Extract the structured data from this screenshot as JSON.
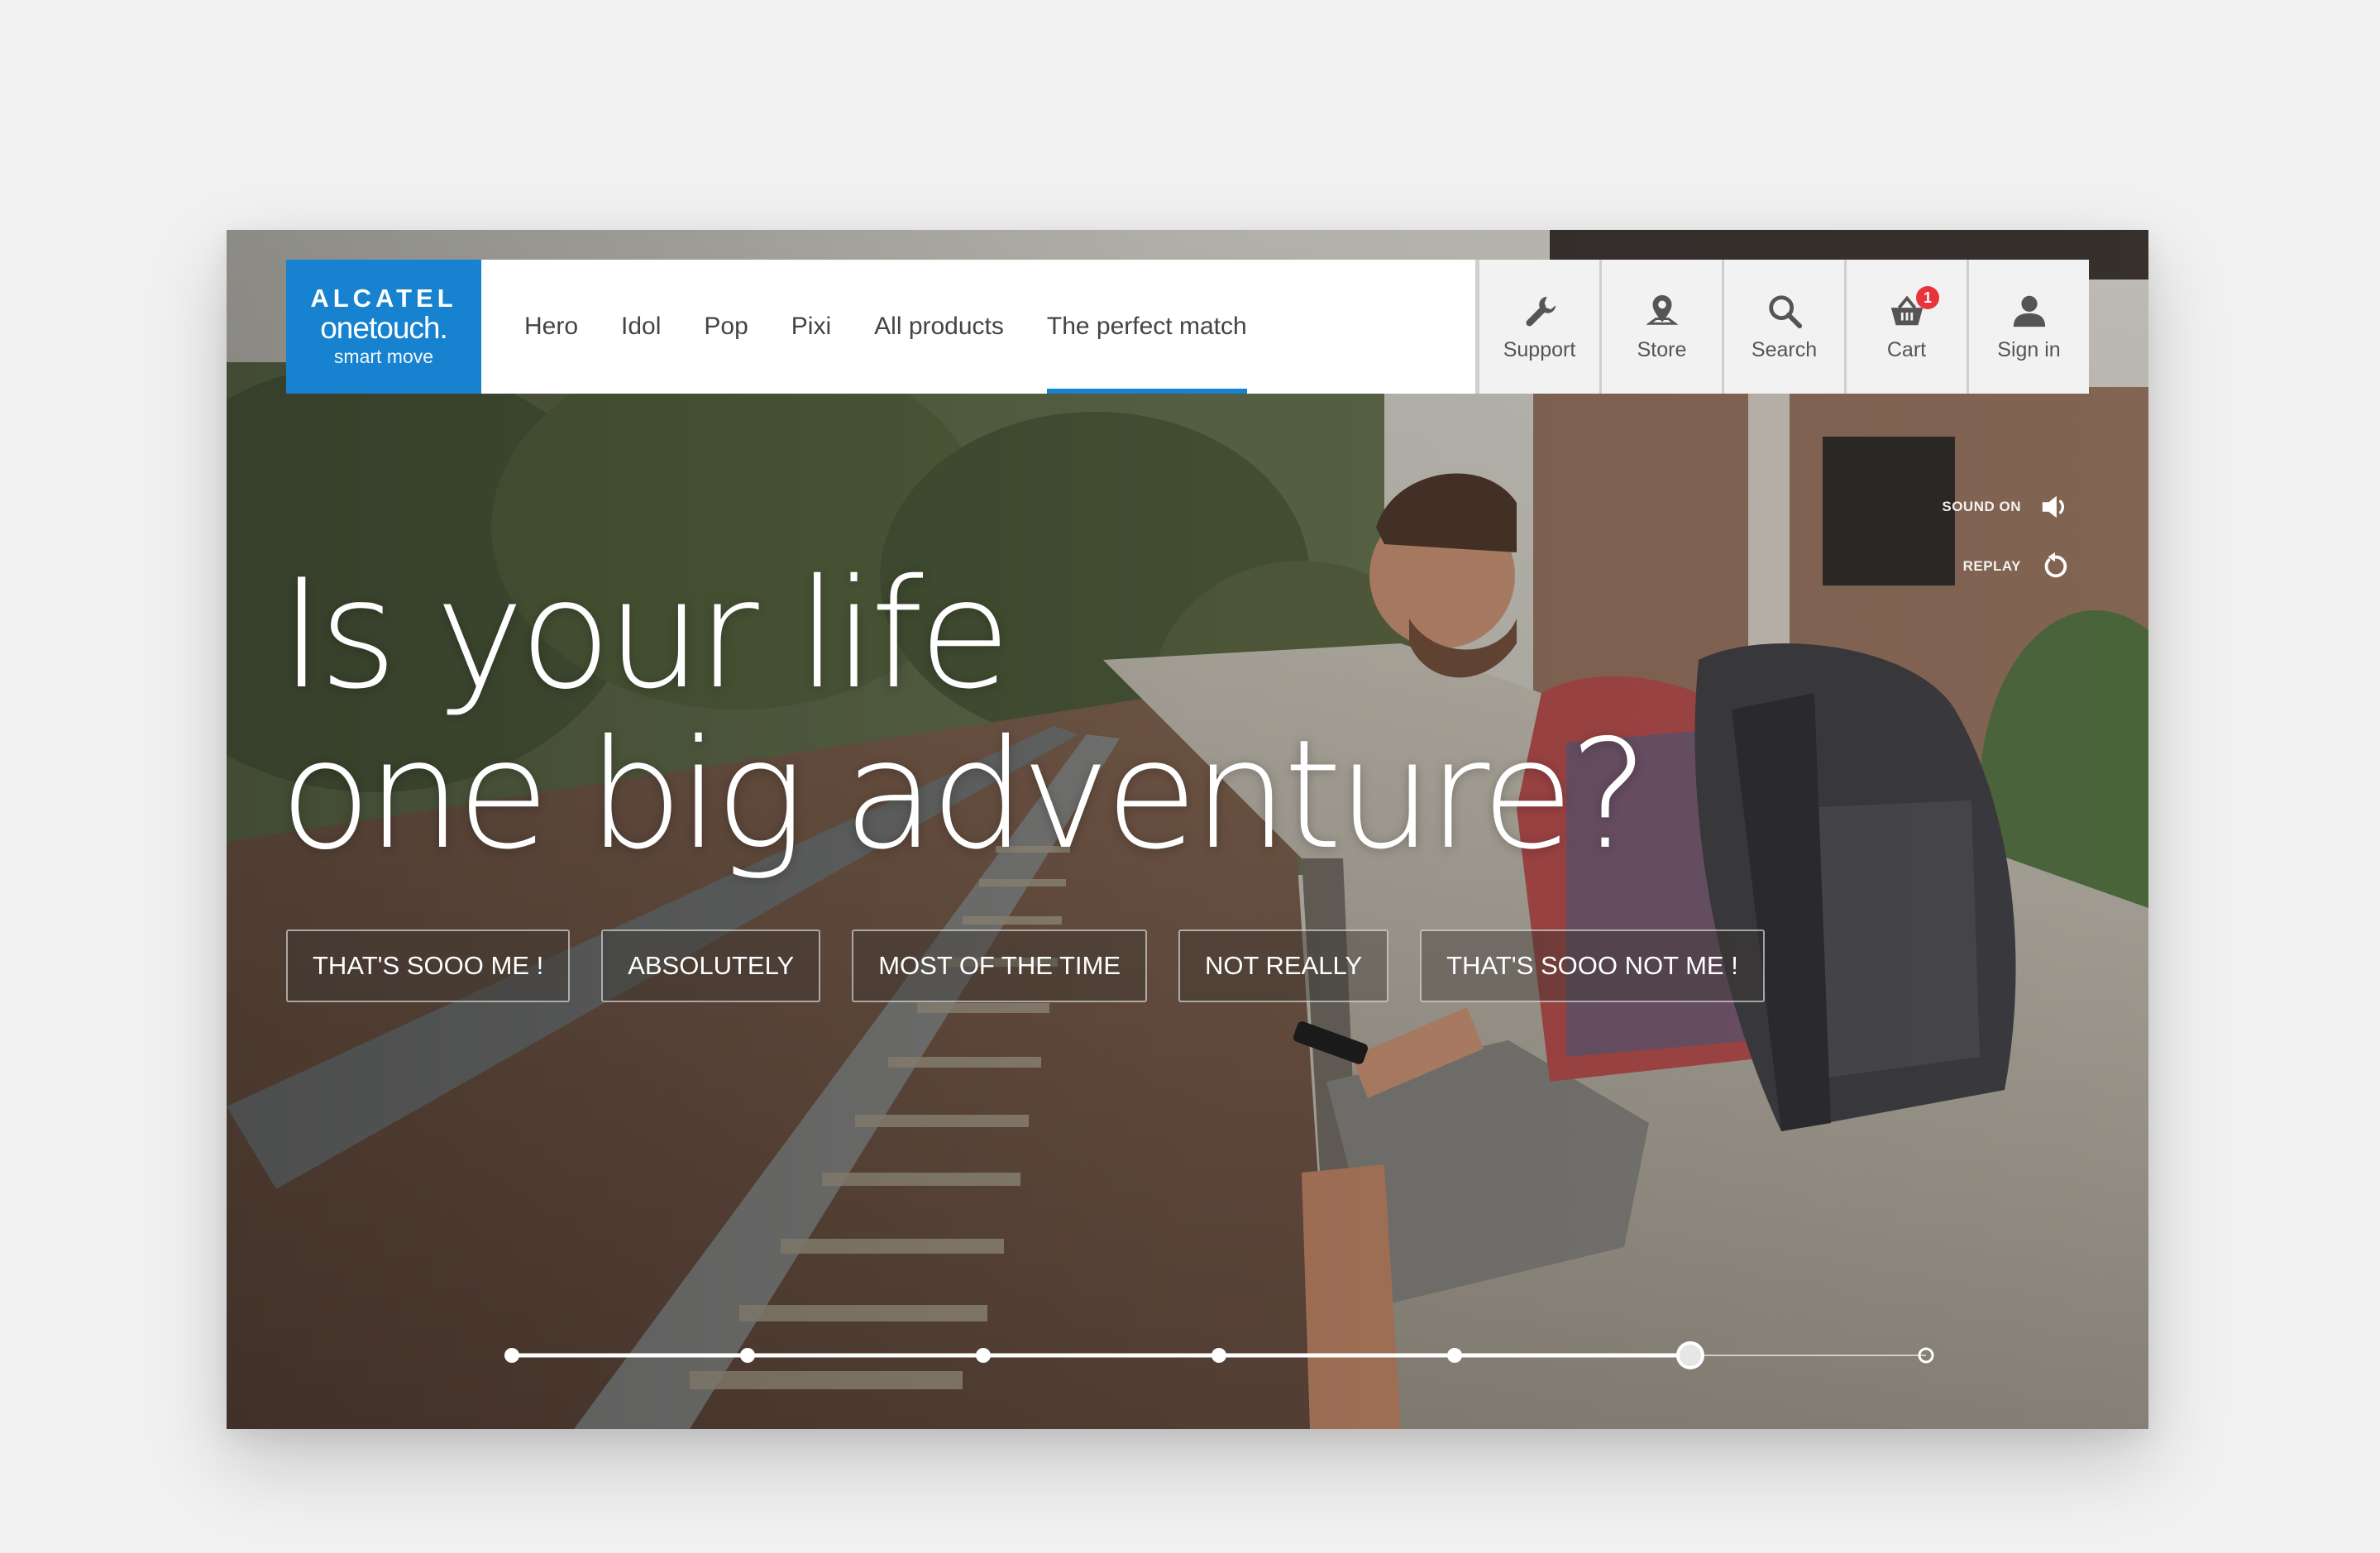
{
  "brand": {
    "line1": "ALCATEL",
    "line2": "onetouch.",
    "line3": "smart move"
  },
  "nav": {
    "items": [
      {
        "label": "Hero"
      },
      {
        "label": "Idol"
      },
      {
        "label": "Pop"
      },
      {
        "label": "Pixi"
      },
      {
        "label": "All products"
      },
      {
        "label": "The perfect match"
      }
    ],
    "active": "The perfect match",
    "actions": [
      {
        "label": "Support",
        "icon": "wrench-icon"
      },
      {
        "label": "Store",
        "icon": "map-pin-icon"
      },
      {
        "label": "Search",
        "icon": "search-icon"
      },
      {
        "label": "Cart",
        "icon": "basket-icon",
        "badge": "1"
      },
      {
        "label": "Sign in",
        "icon": "user-icon"
      }
    ]
  },
  "controls": {
    "sound_label": "SOUND ON",
    "replay_label": "REPLAY"
  },
  "headline": {
    "line1": "Is your life",
    "line2": "one big adventure?"
  },
  "answers": [
    {
      "label": "THAT'S SOOO ME !"
    },
    {
      "label": "ABSOLUTELY"
    },
    {
      "label": "MOST OF THE TIME"
    },
    {
      "label": "NOT REALLY"
    },
    {
      "label": "THAT'S SOOO NOT ME !"
    }
  ],
  "progress": {
    "total_steps": 7,
    "current_step": 6
  },
  "colors": {
    "brand_blue": "#1782cf",
    "badge_red": "#e8353b",
    "nav_bg": "#ffffff",
    "action_bg": "#f2f2f2"
  }
}
